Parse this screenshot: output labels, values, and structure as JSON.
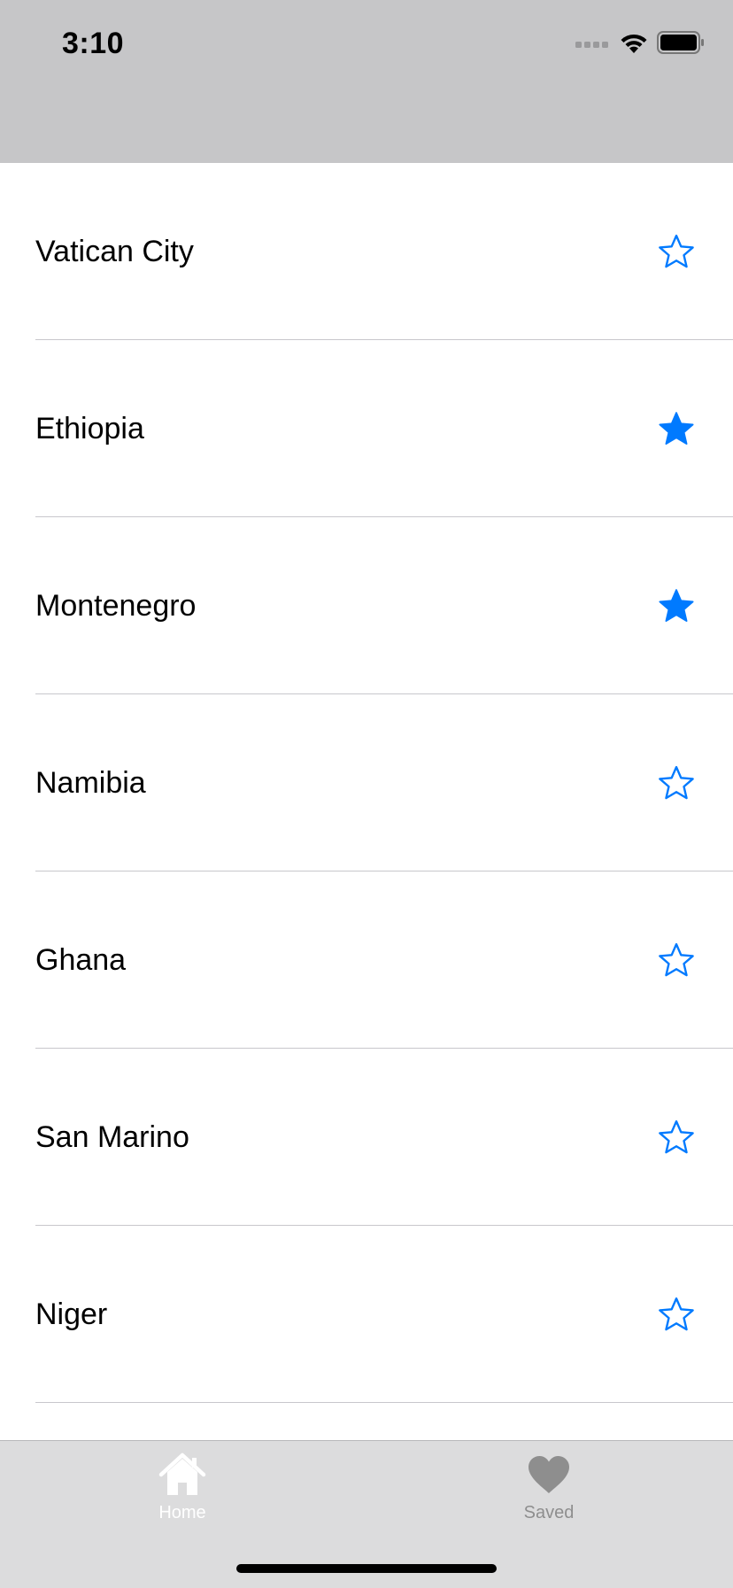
{
  "status_bar": {
    "time": "3:10",
    "icons": [
      "cellular-signal-icon",
      "wifi-icon",
      "battery-icon"
    ]
  },
  "countries": [
    {
      "name": "Vatican City",
      "starred": false
    },
    {
      "name": "Ethiopia",
      "starred": true
    },
    {
      "name": "Montenegro",
      "starred": true
    },
    {
      "name": "Namibia",
      "starred": false
    },
    {
      "name": "Ghana",
      "starred": false
    },
    {
      "name": "San Marino",
      "starred": false
    },
    {
      "name": "Niger",
      "starred": false
    }
  ],
  "tab_bar": {
    "tabs": [
      {
        "label": "Home",
        "icon": "house-icon",
        "selected": true
      },
      {
        "label": "Saved",
        "icon": "heart-icon",
        "selected": false
      }
    ]
  },
  "colors": {
    "accent": "#007aff",
    "header_bg": "#c6c6c8",
    "tab_bar_bg": "#dcdcdd",
    "tab_selected": "#ffffff",
    "tab_unselected": "#8e8e8e"
  }
}
